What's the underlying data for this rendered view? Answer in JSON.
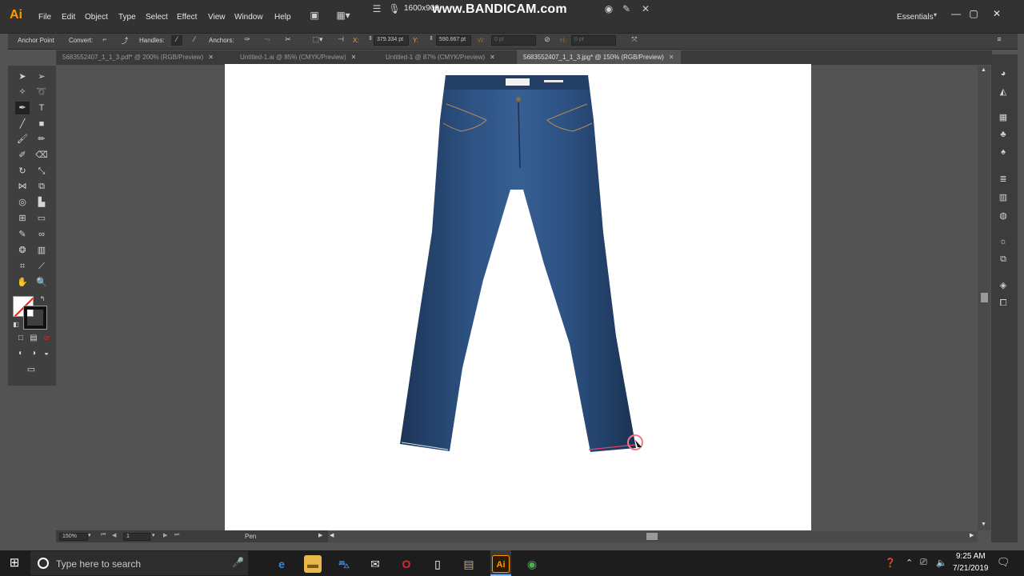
{
  "window": {
    "app_logo": "Ai",
    "menus": [
      "File",
      "Edit",
      "Object",
      "Type",
      "Select",
      "Effect",
      "View",
      "Window",
      "Help"
    ],
    "workspace": "Essentials",
    "recorder": {
      "resolution": "1600x900",
      "watermark": "www.BANDICAM.com"
    }
  },
  "control_bar": {
    "mode_label": "Anchor Point",
    "convert_label": "Convert:",
    "handles_label": "Handles:",
    "anchors_label": "Anchors:",
    "x_label": "X:",
    "x_value": "379.334 pt",
    "y_label": "Y:",
    "y_value": "590.667 pt",
    "w_label": "W:",
    "w_value": "0 pt",
    "h_label": "H:",
    "h_value": "0 pt"
  },
  "tabs": [
    {
      "label": "5683552407_1_1_3.pdf* @ 200% (RGB/Preview)",
      "active": false
    },
    {
      "label": "Untitled-1.ai @ 85% (CMYK/Preview)",
      "active": false
    },
    {
      "label": "Untitled-1 @ 87% (CMYK/Preview)",
      "active": false
    },
    {
      "label": "5683552407_1_1_3.jpg* @ 150% (RGB/Preview)",
      "active": true
    }
  ],
  "status_bar": {
    "zoom": "150%",
    "artboard_number": "1",
    "current_tool": "Pen"
  },
  "colors": {
    "menubar": "#323232",
    "workspace_bg": "#535353",
    "artboard": "#ffffff",
    "denim": "#2a4a73",
    "accent_logo": "#ff9a00"
  },
  "taskbar": {
    "search_placeholder": "Type here to search",
    "time": "9:25 AM",
    "date": "7/21/2019"
  }
}
